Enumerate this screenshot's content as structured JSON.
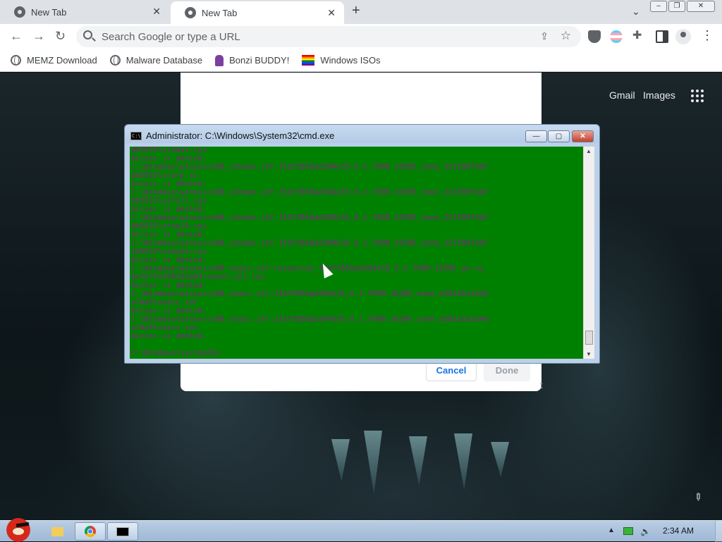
{
  "browser": {
    "tabs": [
      {
        "label": "New Tab",
        "active": false
      },
      {
        "label": "New Tab",
        "active": true
      }
    ],
    "new_tab_symbol": "+",
    "tab_search_symbol": "⌄",
    "omnibox_placeholder": "Search Google or type a URL",
    "bookmarks": [
      {
        "label": "MEMZ Download",
        "icon": "globe-icon"
      },
      {
        "label": "Malware Database",
        "icon": "globe-icon"
      },
      {
        "label": "Bonzi BUDDY!",
        "icon": "bonzi-icon"
      },
      {
        "label": "Windows ISOs",
        "icon": "rainbow-flag-icon"
      }
    ]
  },
  "newtab_page": {
    "links": {
      "gmail": "Gmail",
      "images": "Images"
    }
  },
  "dialog": {
    "cancel_label": "Cancel",
    "done_label": "Done"
  },
  "cmd": {
    "title": "Administrator: C:\\Windows\\System32\\cmd.exe",
    "icon_text": "C:\\",
    "lines": [
      "db5832\\xchdat.sys",
      "Access is denied.",
      "C:\\Windows\\winsxs\\x86_xchdav.inf_31bf3856ad364e35_6.1.7600.16385_none_2323967bb7",
      "db5832\\xcorp.sx",
      "Access is denied.",
      "C:\\Windows\\winsxs\\x86_xchdav.inf_31bf3856ad364e35_6.1.7600.16385_none_2323967bb7",
      "db5832\\xcfull.sys",
      "Access is denied.",
      "C:\\Windows\\winsxs\\x86_xchdav.inf_31bf3856ad364e35_6.1.7600.16385_none_2323967bb7",
      "db5832\\xchal0.sys",
      "Access is denied.",
      "C:\\Windows\\winsxs\\x86_xchdav.inf_31bf3856ad364e35_6.1.7600.16385_none_2323967bb7",
      "db5832\\xcmond.sys",
      "Access is denied.",
      "C:\\Windows\\winsxs\\x86_xnacc.inf.resources_31bf3856ad364e35_6.1.7600.16385_en-us_",
      "8efb77a790163a93\\xnacc.inf_loc",
      "Access is denied.",
      "C:\\Windows\\winsxs\\x86_xnacc.inf_31bf3856ad364e35_6.1.7600.16385_none_b301d1e1d4d",
      "a7da9\\xnacc.inf",
      "Access is denied.",
      "C:\\Windows\\winsxs\\x86_xnacc.inf_31bf3856ad364e35_6.1.7600.16385_none_b301d1e1d4d",
      "a7da9\\xnacc.sys",
      "Access is denied.",
      "",
      "C:\\Windows\\system32>"
    ],
    "colors": {
      "background": "#008000",
      "text": "#8a1c8a"
    }
  },
  "taskbar": {
    "clock": "2:34 AM",
    "apps": [
      "explorer-folder-icon",
      "chrome-icon",
      "cmd-icon"
    ]
  }
}
